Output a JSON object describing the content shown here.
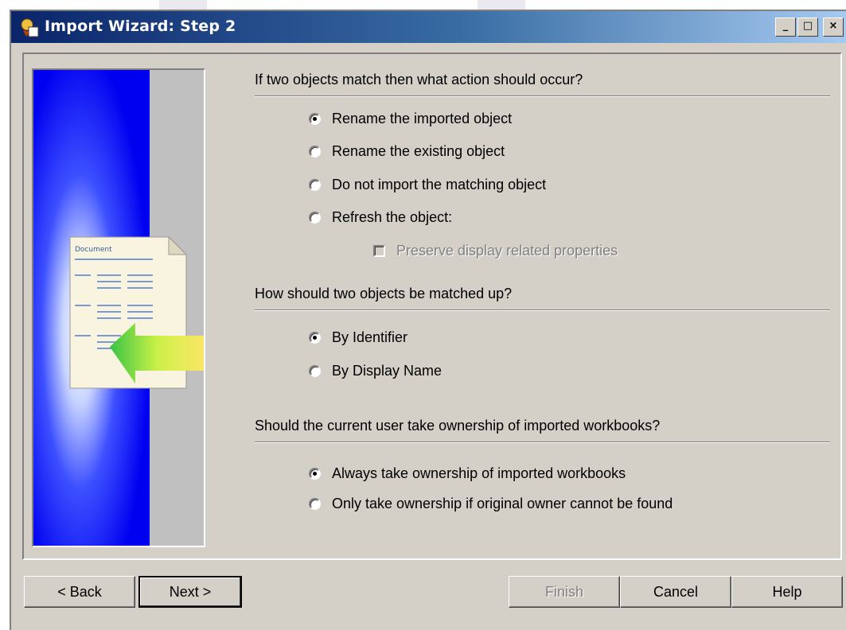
{
  "window": {
    "title": "Import Wizard: Step 2",
    "controls": {
      "minimize": "_",
      "maximize": "□",
      "close": "×"
    }
  },
  "sidebar_image": {
    "doc_heading": "Document"
  },
  "sections": {
    "match_action": {
      "question": "If two objects match then what action should occur?",
      "options": [
        {
          "label": "Rename the imported object",
          "selected": true
        },
        {
          "label": "Rename the existing object",
          "selected": false
        },
        {
          "label": "Do not import the matching object",
          "selected": false
        },
        {
          "label": "Refresh the object:",
          "selected": false
        }
      ],
      "sub_checkbox": {
        "label": "Preserve display related properties",
        "checked": false,
        "enabled": false
      }
    },
    "match_by": {
      "question": "How should two objects be matched up?",
      "options": [
        {
          "label": "By Identifier",
          "selected": true
        },
        {
          "label": "By Display Name",
          "selected": false
        }
      ]
    },
    "ownership": {
      "question": "Should the current user take ownership of imported workbooks?",
      "options": [
        {
          "label": "Always take ownership of imported workbooks",
          "selected": true
        },
        {
          "label": "Only take ownership if original owner cannot be found",
          "selected": false
        }
      ]
    }
  },
  "buttons": {
    "back": "< Back",
    "next": "Next >",
    "finish": "Finish",
    "cancel": "Cancel",
    "help": "Help"
  },
  "colors": {
    "face": "#d4d0c8",
    "title_active_start": "#0a246a",
    "title_active_end": "#a6caf0",
    "sidebar_blue": "#0000ff"
  }
}
